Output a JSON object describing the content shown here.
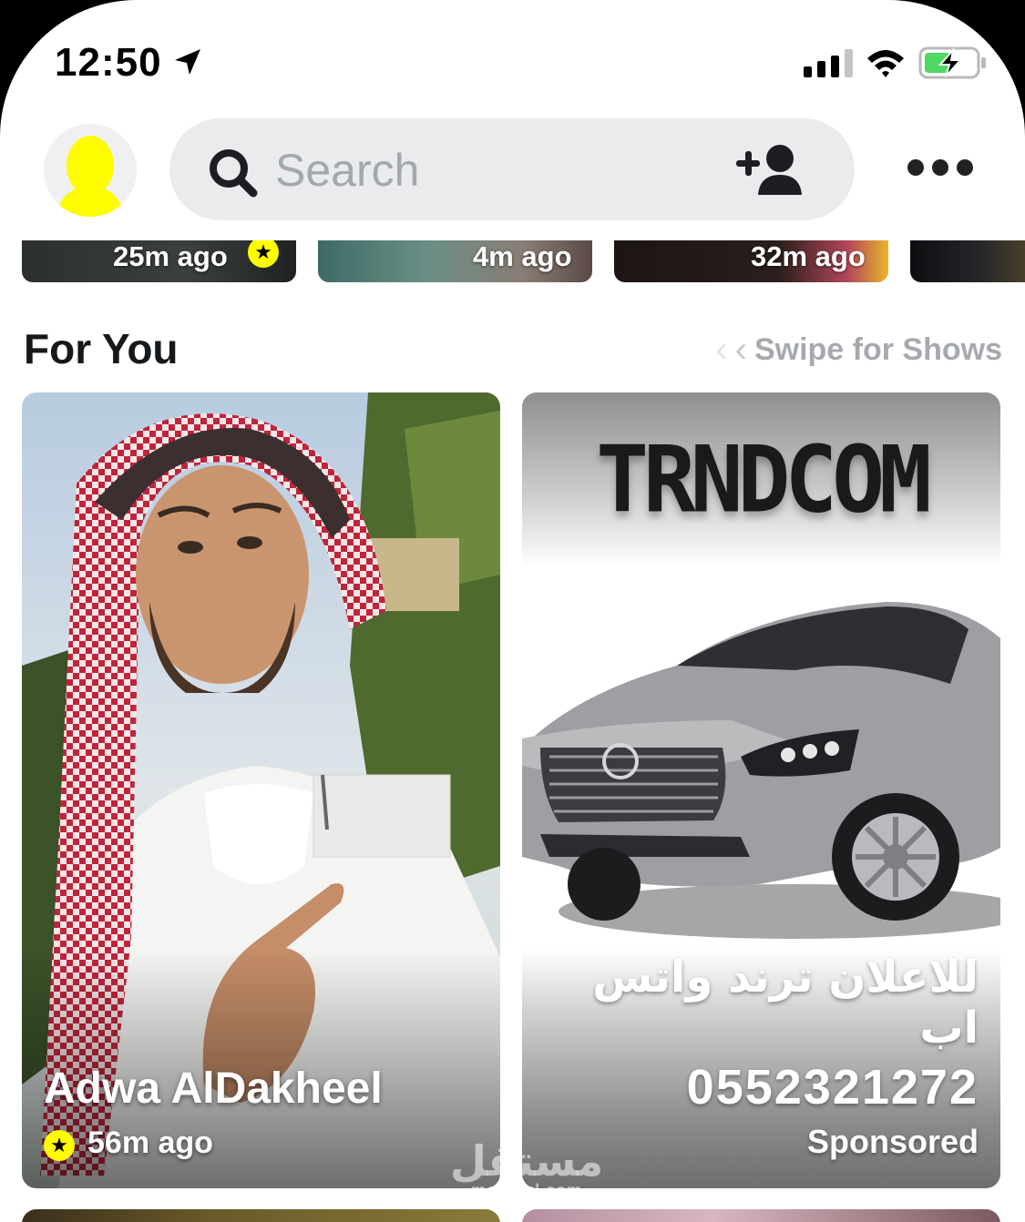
{
  "status_bar": {
    "time": "12:50",
    "icons": [
      "location-arrow-icon",
      "cellular-signal-icon",
      "wifi-icon",
      "battery-charging-icon"
    ]
  },
  "header": {
    "search_placeholder": "Search",
    "icons": [
      "bitmoji-avatar-icon",
      "search-icon",
      "add-friend-icon",
      "more-icon"
    ]
  },
  "story_strip": [
    {
      "time": "25m ago",
      "badge": "star-badge-icon"
    },
    {
      "time": "4m ago"
    },
    {
      "time": "32m ago"
    },
    {
      "time": ""
    }
  ],
  "for_you": {
    "title": "For You",
    "swipe_hint": "Swipe for Shows"
  },
  "tiles": [
    {
      "name": "Adwa AlDakheel",
      "time": "56m ago",
      "badge": "star-badge-icon"
    },
    {
      "brand": "TRNDCOM",
      "arabic_text": "للاعلان ترند واتس اب",
      "phone": "0552321272",
      "label": "Sponsored"
    }
  ],
  "watermark": {
    "arabic": "مستقل",
    "latin": "mostaql.com"
  },
  "colors": {
    "snap_yellow": "#fffc00",
    "battery_green": "#4cd964",
    "hint_gray": "#a6a9ae"
  }
}
